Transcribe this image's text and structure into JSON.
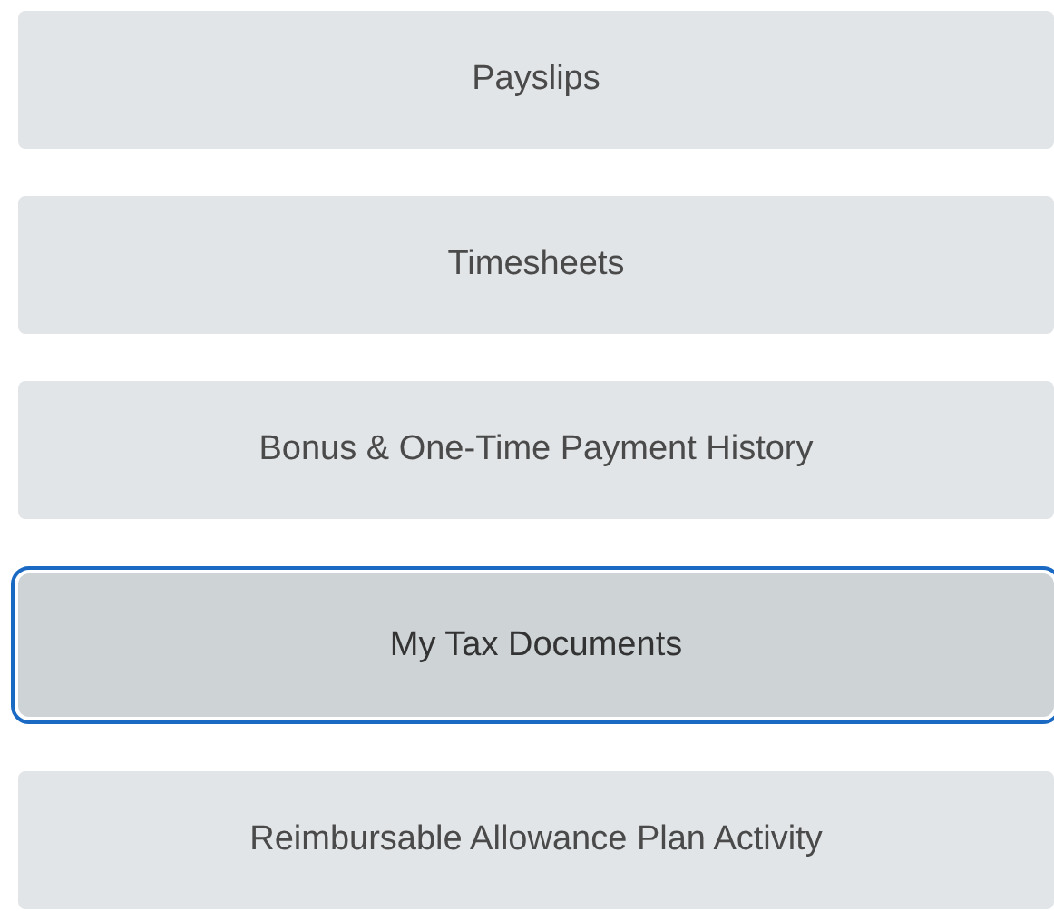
{
  "buttons": [
    {
      "label": "Payslips",
      "selected": false
    },
    {
      "label": "Timesheets",
      "selected": false
    },
    {
      "label": "Bonus & One-Time Payment History",
      "selected": false
    },
    {
      "label": "My Tax Documents",
      "selected": true
    },
    {
      "label": "Reimbursable Allowance Plan Activity",
      "selected": false
    }
  ]
}
